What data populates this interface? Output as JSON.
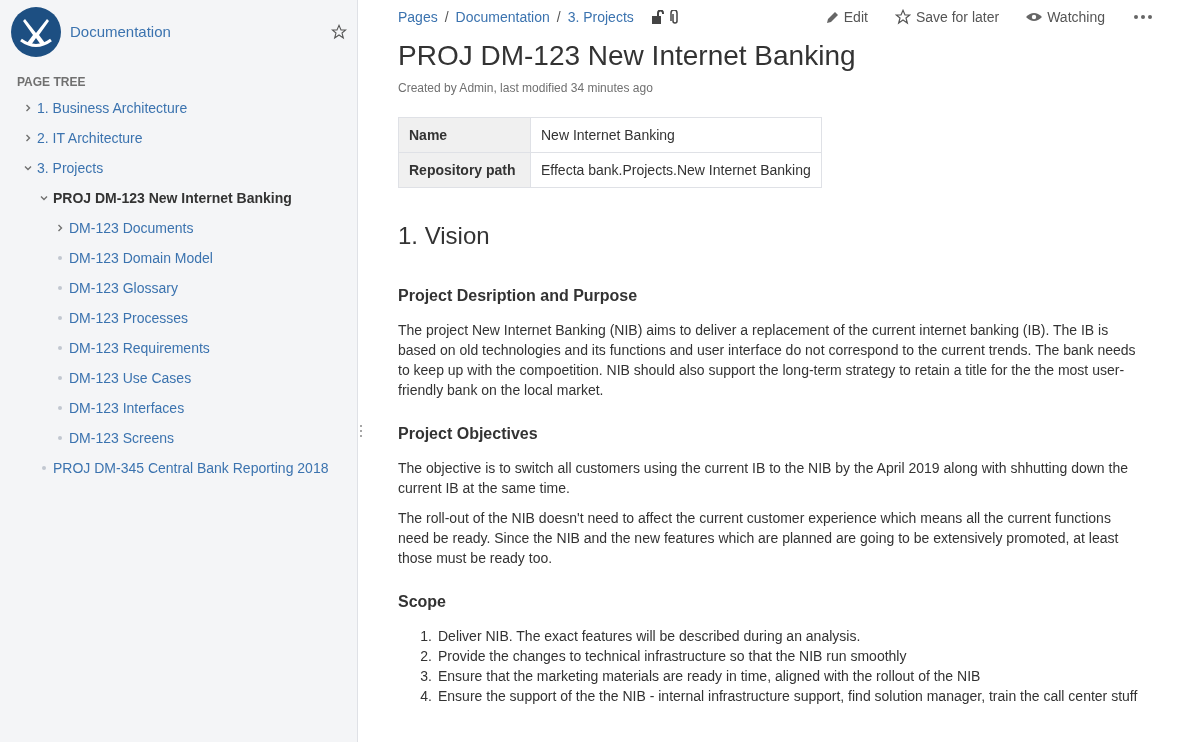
{
  "sidebar": {
    "space_name": "Documentation",
    "section_title": "PAGE TREE",
    "tree": [
      {
        "label": "1. Business Architecture",
        "kind": "branch",
        "expanded": false,
        "selected": false
      },
      {
        "label": "2. IT Architecture",
        "kind": "branch",
        "expanded": false,
        "selected": false
      },
      {
        "label": "3. Projects",
        "kind": "branch",
        "expanded": true,
        "selected": false,
        "children": [
          {
            "label": "PROJ DM-123 New Internet Banking",
            "kind": "branch",
            "expanded": true,
            "selected": true,
            "children": [
              {
                "label": "DM-123 Documents",
                "kind": "branch",
                "expanded": false,
                "selected": false
              },
              {
                "label": "DM-123 Domain Model",
                "kind": "leaf",
                "selected": false
              },
              {
                "label": "DM-123 Glossary",
                "kind": "leaf",
                "selected": false
              },
              {
                "label": "DM-123 Processes",
                "kind": "leaf",
                "selected": false
              },
              {
                "label": "DM-123 Requirements",
                "kind": "leaf",
                "selected": false
              },
              {
                "label": "DM-123 Use Cases",
                "kind": "leaf",
                "selected": false
              },
              {
                "label": "DM-123 Interfaces",
                "kind": "leaf",
                "selected": false
              },
              {
                "label": "DM-123 Screens",
                "kind": "leaf",
                "selected": false
              }
            ]
          },
          {
            "label": "PROJ DM-345 Central Bank Reporting 2018",
            "kind": "leaf",
            "selected": false
          }
        ]
      }
    ]
  },
  "breadcrumbs": [
    "Pages",
    "Documentation",
    "3. Projects"
  ],
  "breadcrumb_separator": "/",
  "actions": [
    {
      "kind": "edit",
      "label": "Edit"
    },
    {
      "kind": "save",
      "label": "Save for later"
    },
    {
      "kind": "watch",
      "label": "Watching"
    },
    {
      "kind": "more"
    }
  ],
  "page": {
    "title": "PROJ DM-123 New Internet Banking",
    "byline": "Created by Admin, last modified 34 minutes ago",
    "properties": [
      {
        "key": "Name",
        "value": "New Internet Banking"
      },
      {
        "key": "Repository path",
        "value": "Effecta bank.Projects.New Internet Banking"
      }
    ],
    "blocks": [
      {
        "kind": "h1",
        "text": "1. Vision"
      },
      {
        "kind": "h3",
        "text": "Project Desription and Purpose"
      },
      {
        "kind": "p",
        "text": "The project New Internet Banking (NIB) aims to deliver a replacement of the current internet banking (IB). The IB is based on old technologies and its functions and user interface do not correspond to the current trends. The bank needs to keep up with the compoetition. NIB should also support the long-term strategy to retain a title for the the most user-friendly bank on the local market."
      },
      {
        "kind": "h3",
        "text": "Project Objectives"
      },
      {
        "kind": "p",
        "text": "The objective is to switch all customers using the current IB to the NIB by the April 2019 along with shhutting down the current IB at the same time."
      },
      {
        "kind": "p",
        "text": "The roll-out of the NIB doesn't need to affect the current customer experience which means all the current functions need be ready. Since the NIB and the new features which are planned are going to be extensively promoted, at least those must be ready too."
      },
      {
        "kind": "h3",
        "text": "Scope"
      },
      {
        "kind": "ol",
        "items": [
          {
            "number": "1.",
            "text": "Deliver NIB. The exact features will be described during an analysis."
          },
          {
            "number": "2.",
            "text": "Provide the changes to technical infrastructure so that the NIB run smoothly"
          },
          {
            "number": "3.",
            "text": "Ensure that the marketing materials are ready in time, aligned with the rollout of the NIB"
          },
          {
            "number": "4.",
            "text": "Ensure the support of the the NIB - internal infrastructure support, find solution manager, train the call center stuff"
          }
        ]
      }
    ]
  }
}
